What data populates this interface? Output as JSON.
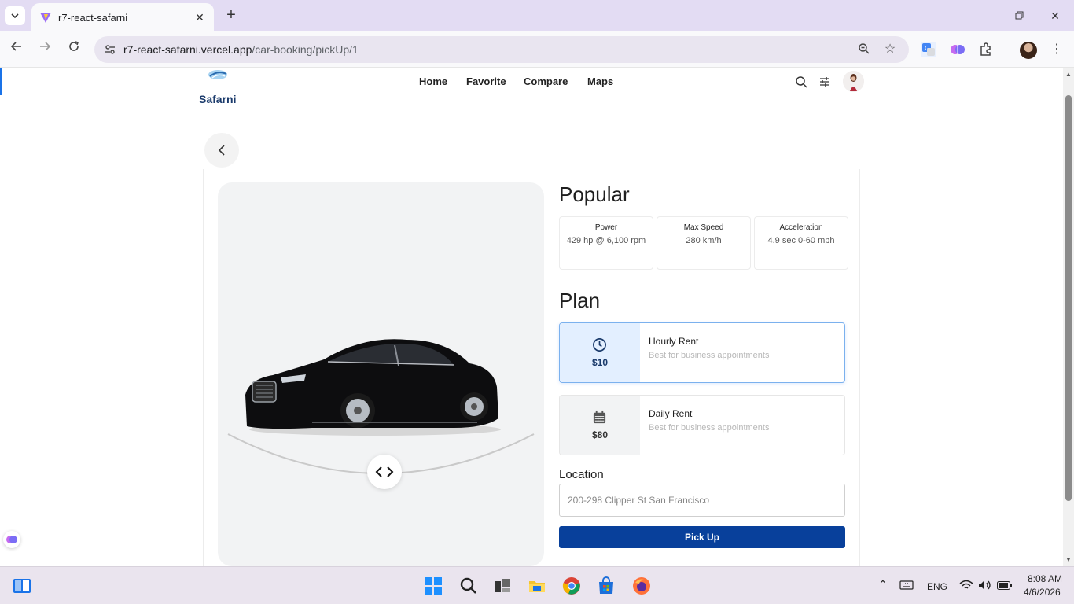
{
  "browser": {
    "tab_title": "r7-react-safarni",
    "url_host": "r7-react-safarni.vercel.app",
    "url_path": "/car-booking/pickUp/1"
  },
  "site": {
    "logo_text": "Safarni",
    "nav": [
      "Home",
      "Favorite",
      "Compare",
      "Maps"
    ]
  },
  "car": {
    "section_title": "Popular",
    "specs": [
      {
        "label": "Power",
        "value": "429 hp @ 6,100 rpm"
      },
      {
        "label": "Max Speed",
        "value": "280 km/h"
      },
      {
        "label": "Acceleration",
        "value": "4.9 sec 0-60 mph"
      }
    ]
  },
  "plan": {
    "section_title": "Plan",
    "options": [
      {
        "title": "Hourly Rent",
        "desc": "Best for business appointments",
        "price": "$10",
        "icon": "clock-icon",
        "selected": true
      },
      {
        "title": "Daily Rent",
        "desc": "Best for business appointments",
        "price": "$80",
        "icon": "calendar-icon",
        "selected": false
      }
    ]
  },
  "location": {
    "label": "Location",
    "value": "200-298 Clipper St San Francisco"
  },
  "pickup_label": "Pick Up",
  "taskbar": {
    "lang": "ENG",
    "time": "8:08 AM",
    "date": "4/6/2026"
  },
  "colors": {
    "primary": "#08409b",
    "selected_bg": "#e3efff",
    "panel_bg": "#f2f3f4"
  }
}
